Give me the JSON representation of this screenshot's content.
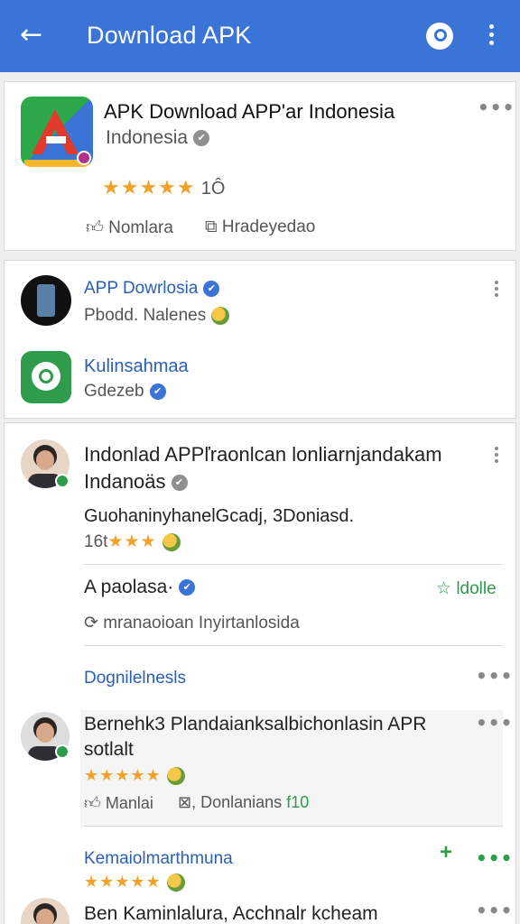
{
  "app_bar": {
    "title": "Download APK"
  },
  "header_card": {
    "app_name": "APK Download APP'ar Indonesia",
    "publisher": "Indonesia",
    "stars": "★★★★★",
    "rating_extra": "1Ô",
    "action_1": "Nomlara",
    "action_2": "Hradeyedao"
  },
  "accounts": [
    {
      "name": "APP Dowrlosia",
      "sub": "Pbodd. Nalenes"
    },
    {
      "name": "Kulinsahmaa",
      "sub": "Gdezeb"
    }
  ],
  "post_1": {
    "title_line1": "Indonlad APPľraonlcan lonliarnjandakam",
    "title_line2": "Indanoäs",
    "body": "GuohaninyhanelGcadj, 3Doniasd.",
    "rating_prefix": "16t",
    "stars": "★★★"
  },
  "reply_1": {
    "author": "A paolasa·",
    "follow": "ldolle",
    "text": "mranaoioan Inyirtanlosida"
  },
  "section_2": {
    "title": "Dognilelnesls"
  },
  "post_2": {
    "title_line1": "Bernehk3 Plandaianksalbichonlasin APR",
    "title_line2": "sotlalt",
    "stars": "★★★★★",
    "action_1": "Manlai",
    "action_2": ", Donlanians",
    "count": "f10"
  },
  "section_3": {
    "title": "Kemaiolmarthmuna",
    "stars": "★★★★★"
  },
  "post_3": {
    "title": "Ben Kaminlalura, Acchnalr kcheam"
  }
}
